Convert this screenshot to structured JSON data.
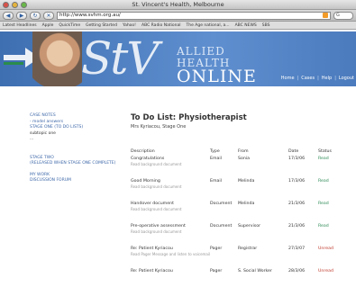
{
  "window": {
    "title": "St. Vincent's Health, Melbourne"
  },
  "toolbar": {
    "url": "http://www.svhm.org.au/",
    "search_placeholder": "G"
  },
  "bookmarks": [
    "Latest Headlines",
    "Apple",
    "QuickTime",
    "Getting Started",
    "Yahoo!",
    "ABC Radio National",
    "The Age national, a...",
    "ABC NEWS",
    "SBS"
  ],
  "banner": {
    "logo": "StV",
    "line1": "ALLIED",
    "line2": "HEALTH",
    "line3": "ONLINE"
  },
  "topnav": [
    "Home",
    "Cases",
    "Help",
    "Logout"
  ],
  "sidebar": {
    "items": [
      {
        "label": "CASE NOTES",
        "type": "link"
      },
      {
        "label": "- model answers",
        "type": "link"
      },
      {
        "label": "STAGE ONE (TO DO LISTS)",
        "type": "link"
      },
      {
        "label": "subtopic one",
        "type": "text"
      },
      {
        "label": "...",
        "type": "text"
      },
      {
        "label": "STAGE TWO",
        "type": "link"
      },
      {
        "label": "(RELEASED WHEN STAGE ONE COMPLETE)",
        "type": "link"
      },
      {
        "label": "MY WORK",
        "type": "link"
      },
      {
        "label": "DISCUSSION FORUM",
        "type": "link"
      }
    ]
  },
  "main": {
    "title": "To Do List: Physiotherapist",
    "subtitle": "Mrs Kyriacou, Stage One"
  },
  "table": {
    "headers": [
      "Description",
      "Type",
      "From",
      "Date",
      "Status"
    ],
    "rows": [
      {
        "desc": "Congratulations",
        "note": "Read background document",
        "type": "Email",
        "from": "Sonia",
        "date": "17/3/06",
        "status": "Read"
      },
      {
        "desc": "Good Morning",
        "note": "Read background document",
        "type": "Email",
        "from": "Melinda",
        "date": "17/3/06",
        "status": "Read"
      },
      {
        "desc": "Handover document",
        "note": "Read background document",
        "type": "Document",
        "from": "Melinda",
        "date": "21/3/06",
        "status": "Read"
      },
      {
        "desc": "Pre-operative assessment",
        "note": "Read background document",
        "type": "Document",
        "from": "Supervisor",
        "date": "21/3/06",
        "status": "Read"
      },
      {
        "desc": "Re: Patient Kyriacou",
        "note": "Read Pager Message and listen to voicemail",
        "type": "Pager",
        "from": "Registrar",
        "date": "27/3/07",
        "status": "Unread"
      },
      {
        "desc": "Re: Patient Kyriacou",
        "note": "",
        "type": "Pager",
        "from": "S. Social Worker",
        "date": "28/3/06",
        "status": "Unread"
      }
    ]
  },
  "colors": {
    "link": "#3d67a8",
    "read": "#2e8b57",
    "unread": "#c0392b",
    "banner": "#4b7bbd"
  }
}
